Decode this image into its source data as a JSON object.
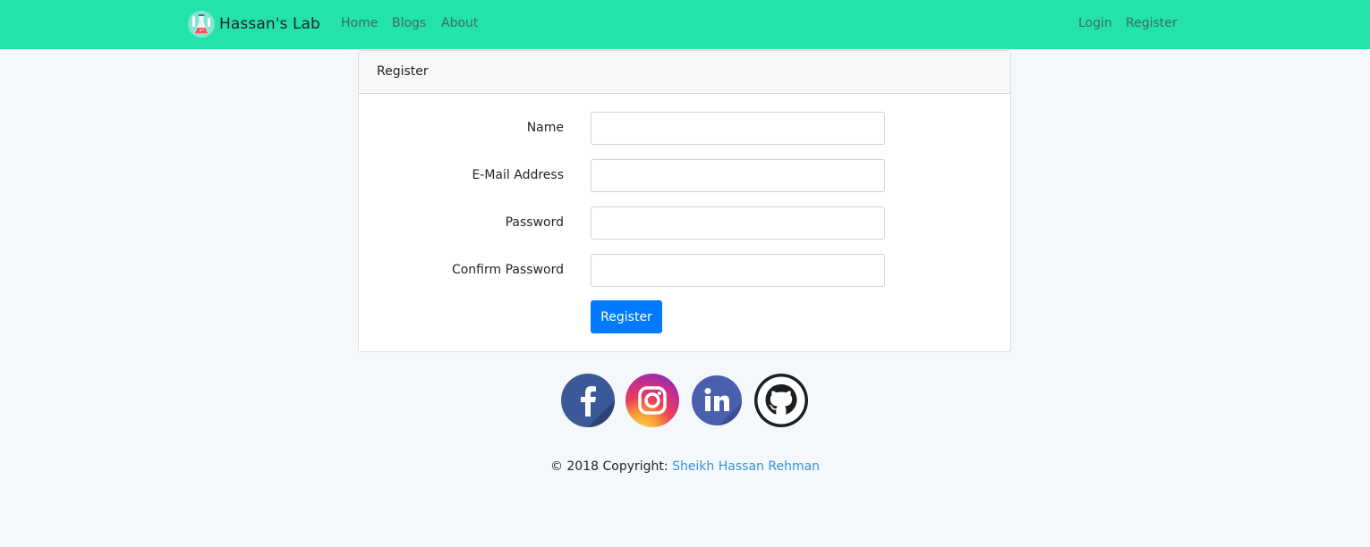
{
  "navbar": {
    "brand_text": "Hassan's Lab",
    "brand_icon": "flask-logo-icon",
    "left_links": [
      "Home",
      "Blogs",
      "About"
    ],
    "right_links": [
      "Login",
      "Register"
    ],
    "background": "#23e2aa"
  },
  "card": {
    "header": "Register",
    "fields": [
      {
        "label": "Name",
        "value": "",
        "type": "text"
      },
      {
        "label": "E-Mail Address",
        "value": "",
        "type": "email"
      },
      {
        "label": "Password",
        "value": "",
        "type": "password"
      },
      {
        "label": "Confirm Password",
        "value": "",
        "type": "password"
      }
    ],
    "submit_label": "Register",
    "submit_color": "#007bff"
  },
  "social": [
    {
      "name": "facebook-icon",
      "color": "#3b5998"
    },
    {
      "name": "instagram-icon",
      "color": "#dd2a7b"
    },
    {
      "name": "linkedin-icon",
      "color": "#4a5fae"
    },
    {
      "name": "github-icon",
      "color": "#1b1f23"
    }
  ],
  "footer": {
    "copyright_prefix": "© 2018 Copyright: ",
    "author_link": "Sheikh Hassan Rehman",
    "link_color": "#3490dc"
  }
}
